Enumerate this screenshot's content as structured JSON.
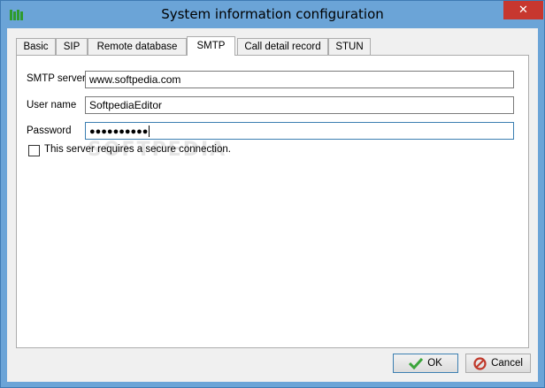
{
  "window": {
    "title": "System information configuration",
    "close_label": "✕"
  },
  "tabs": [
    {
      "label": "Basic"
    },
    {
      "label": "SIP"
    },
    {
      "label": "Remote database"
    },
    {
      "label": "SMTP",
      "active": true
    },
    {
      "label": "Call detail record"
    },
    {
      "label": "STUN"
    }
  ],
  "smtp": {
    "server_label": "SMTP server",
    "server_value": "www.softpedia.com",
    "username_label": "User name",
    "username_value": "SoftpediaEditor",
    "password_label": "Password",
    "password_value": "●●●●●●●●●●",
    "secure_label": "This server requires a secure connection.",
    "secure_checked": false
  },
  "watermark": "SOFTPEDIA",
  "buttons": {
    "ok_label": "OK",
    "cancel_label": "Cancel"
  },
  "colors": {
    "titlebar": "#6ba4d7",
    "close": "#c7372f",
    "ok_icon": "#3aa53a",
    "cancel_icon": "#c0392b"
  }
}
